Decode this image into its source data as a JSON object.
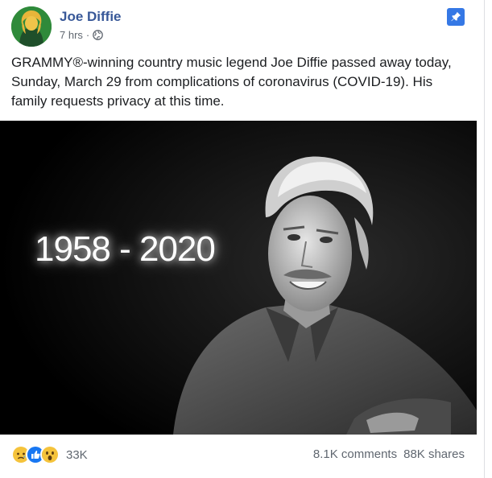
{
  "post": {
    "author": "Joe Diffie",
    "time": "7 hrs",
    "meta_separator": "·",
    "text": "GRAMMY®-winning country music legend Joe Diffie passed away today, Sunday, March 29 from complications of coronavirus (COVID-19). His family requests privacy at this time.",
    "image": {
      "overlay_text": "1958 - 2020"
    }
  },
  "reactions": {
    "icons": [
      "sad-reaction-icon",
      "like-reaction-icon",
      "wow-reaction-icon"
    ],
    "count": "33K"
  },
  "stats": {
    "comments": "8.1K comments",
    "shares": "88K shares"
  },
  "colors": {
    "author_link": "#385898",
    "pin_badge": "#3578e5",
    "secondary_text": "#606770"
  }
}
